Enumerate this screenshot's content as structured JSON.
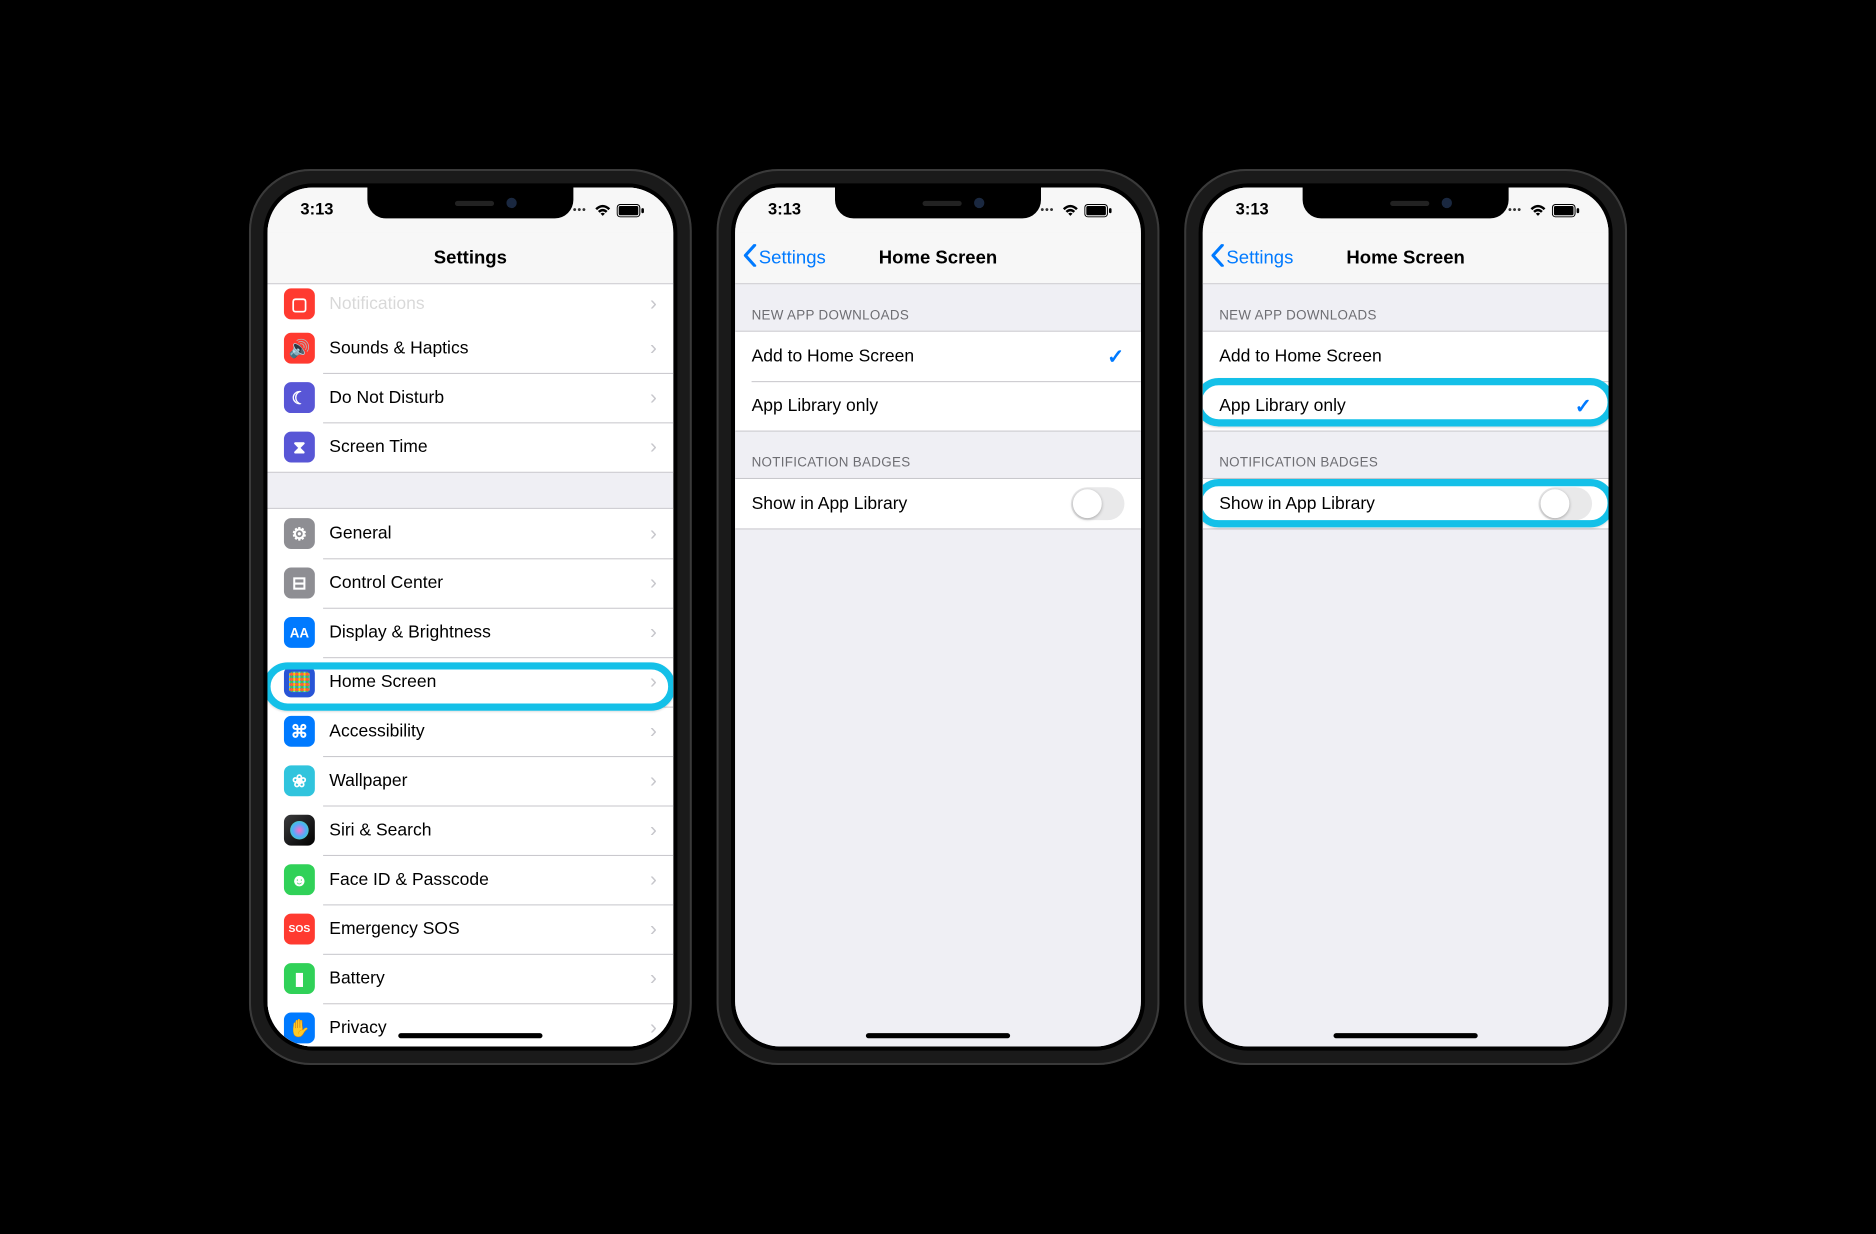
{
  "statusbar": {
    "time": "3:13"
  },
  "phone1": {
    "title": "Settings",
    "partial_top": "Notifications",
    "group1": [
      {
        "label": "Sounds & Haptics",
        "icon": "sounds-icon",
        "cls": "ic-red",
        "glyph": "🔊"
      },
      {
        "label": "Do Not Disturb",
        "icon": "dnd-icon",
        "cls": "ic-purple",
        "glyph": "☾"
      },
      {
        "label": "Screen Time",
        "icon": "screentime-icon",
        "cls": "ic-purple",
        "glyph": "⧗"
      }
    ],
    "group2": [
      {
        "label": "General",
        "icon": "general-icon",
        "cls": "ic-gray",
        "glyph": "⚙"
      },
      {
        "label": "Control Center",
        "icon": "controlcenter-icon",
        "cls": "ic-gray",
        "glyph": "⊟"
      },
      {
        "label": "Display & Brightness",
        "icon": "display-icon",
        "cls": "ic-blue",
        "glyph": "AA"
      },
      {
        "label": "Home Screen",
        "icon": "homescreen-icon",
        "cls": "ic-homescreen",
        "glyph": ""
      },
      {
        "label": "Accessibility",
        "icon": "accessibility-icon",
        "cls": "ic-blue",
        "glyph": "⌘"
      },
      {
        "label": "Wallpaper",
        "icon": "wallpaper-icon",
        "cls": "ic-cyan",
        "glyph": "❀"
      },
      {
        "label": "Siri & Search",
        "icon": "siri-icon",
        "cls": "ic-siri",
        "glyph": ""
      },
      {
        "label": "Face ID & Passcode",
        "icon": "faceid-icon",
        "cls": "ic-green",
        "glyph": "☻"
      },
      {
        "label": "Emergency SOS",
        "icon": "sos-icon",
        "cls": "ic-red",
        "glyph": "SOS"
      },
      {
        "label": "Battery",
        "icon": "battery-icon",
        "cls": "ic-green",
        "glyph": "▮"
      },
      {
        "label": "Privacy",
        "icon": "privacy-icon",
        "cls": "ic-blue",
        "glyph": "✋"
      }
    ],
    "highlight_index": 3
  },
  "phone2": {
    "back": "Settings",
    "title": "Home Screen",
    "section1_header": "NEW APP DOWNLOADS",
    "section1": [
      {
        "label": "Add to Home Screen",
        "checked": true
      },
      {
        "label": "App Library only",
        "checked": false
      }
    ],
    "section2_header": "NOTIFICATION BADGES",
    "section2_row": "Show in App Library",
    "toggle_on": false
  },
  "phone3": {
    "back": "Settings",
    "title": "Home Screen",
    "section1_header": "NEW APP DOWNLOADS",
    "section1": [
      {
        "label": "Add to Home Screen",
        "checked": false
      },
      {
        "label": "App Library only",
        "checked": true
      }
    ],
    "section2_header": "NOTIFICATION BADGES",
    "section2_row": "Show in App Library",
    "toggle_on": false
  }
}
